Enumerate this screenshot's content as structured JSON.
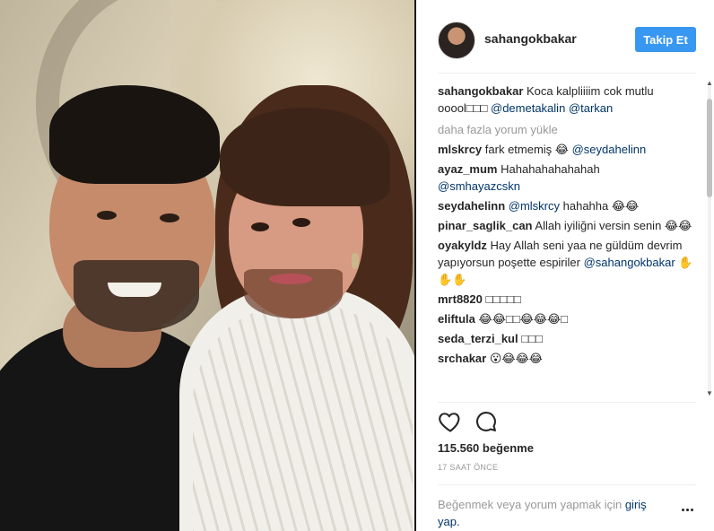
{
  "post": {
    "username": "sahangokbakar",
    "follow_label": "Takip Et",
    "caption": {
      "user": "sahangokbakar",
      "text": "Koca kalpliiiim cok mutlu ooool□□□",
      "mentions": [
        "@demetakalin",
        "@tarkan"
      ]
    },
    "load_more": "daha fazla yorum yükle",
    "comments": [
      {
        "user": "mlskrcy",
        "text": "fark etmemiş 😂",
        "mention": "@seydahelinn",
        "after": ""
      },
      {
        "user": "ayaz_mum",
        "text": "Hahahahahahahah",
        "mention": "@smhayazcskn",
        "after": ""
      },
      {
        "user": "seydahelinn",
        "text": "",
        "mention": "@mlskrcy",
        "after": "hahahha 😂😂"
      },
      {
        "user": "pinar_saglik_can",
        "text": "Allah iyiliğni versin senin 😂😂",
        "mention": "",
        "after": ""
      },
      {
        "user": "oyakyldz",
        "text": "Hay Allah seni yaa ne güldüm devrim yapıyorsun poşette espiriler",
        "mention": "@sahangokbakar",
        "after": "✋✋✋"
      },
      {
        "user": "mrt8820",
        "text": "□□□□□",
        "mention": "",
        "after": ""
      },
      {
        "user": "eliftula",
        "text": "😂😂□□😂😂😂□",
        "mention": "",
        "after": ""
      },
      {
        "user": "seda_terzi_kul",
        "text": "□□□",
        "mention": "",
        "after": ""
      },
      {
        "user": "srchakar",
        "text": "😮😂😂😂",
        "mention": "",
        "after": ""
      }
    ],
    "likes": "115.560 beğenme",
    "time_ago": "17 SAAT ÖNCE",
    "login_prompt": "Beğenmek veya yorum yapmak için",
    "login_link_1": "giriş",
    "login_link_2": "yap.",
    "icons": {
      "like": "heart-icon",
      "comment": "comment-icon",
      "more": "more-options-icon"
    },
    "colors": {
      "follow_button": "#3897f0",
      "mention": "#003569",
      "muted": "#999999"
    }
  }
}
